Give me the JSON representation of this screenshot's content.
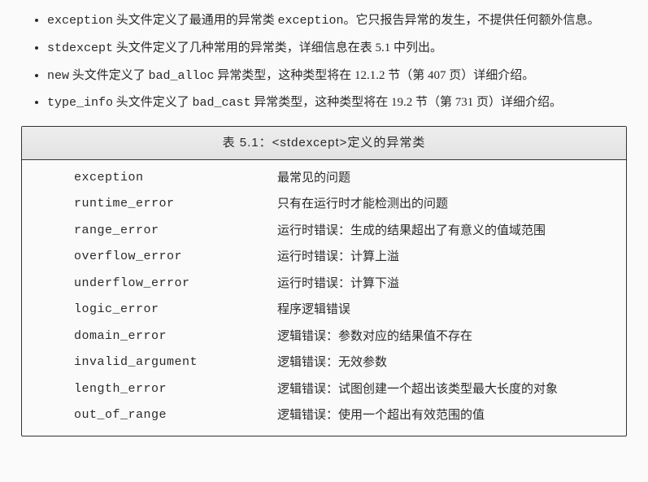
{
  "bullets": [
    {
      "pre": "",
      "code1": "exception",
      "mid1": " 头文件定义了最通用的异常类 ",
      "code2": "exception",
      "tail": "。它只报告异常的发生，不提供任何额外信息。"
    },
    {
      "pre": "",
      "code1": "stdexcept",
      "mid1": " 头文件定义了几种常用的异常类，详细信息在表 5.1 中列出。",
      "code2": "",
      "tail": ""
    },
    {
      "pre": "",
      "code1": "new",
      "mid1": " 头文件定义了 ",
      "code2": "bad_alloc",
      "tail": " 异常类型，这种类型将在 12.1.2 节（第 407 页）详细介绍。"
    },
    {
      "pre": "",
      "code1": "type_info",
      "mid1": " 头文件定义了 ",
      "code2": "bad_cast",
      "tail": " 异常类型，这种类型将在 19.2 节（第 731 页）详细介绍。"
    }
  ],
  "table": {
    "title": "表 5.1：<stdexcept>定义的异常类",
    "rows": [
      {
        "name": "exception",
        "desc": "最常见的问题"
      },
      {
        "name": "runtime_error",
        "desc": "只有在运行时才能检测出的问题"
      },
      {
        "name": "range_error",
        "desc": "运行时错误：生成的结果超出了有意义的值域范围"
      },
      {
        "name": "overflow_error",
        "desc": "运行时错误：计算上溢"
      },
      {
        "name": "underflow_error",
        "desc": "运行时错误：计算下溢"
      },
      {
        "name": "logic_error",
        "desc": "程序逻辑错误"
      },
      {
        "name": "domain_error",
        "desc": "逻辑错误：参数对应的结果值不存在"
      },
      {
        "name": "invalid_argument",
        "desc": "逻辑错误：无效参数"
      },
      {
        "name": "length_error",
        "desc": "逻辑错误：试图创建一个超出该类型最大长度的对象"
      },
      {
        "name": "out_of_range",
        "desc": "逻辑错误：使用一个超出有效范围的值"
      }
    ]
  }
}
